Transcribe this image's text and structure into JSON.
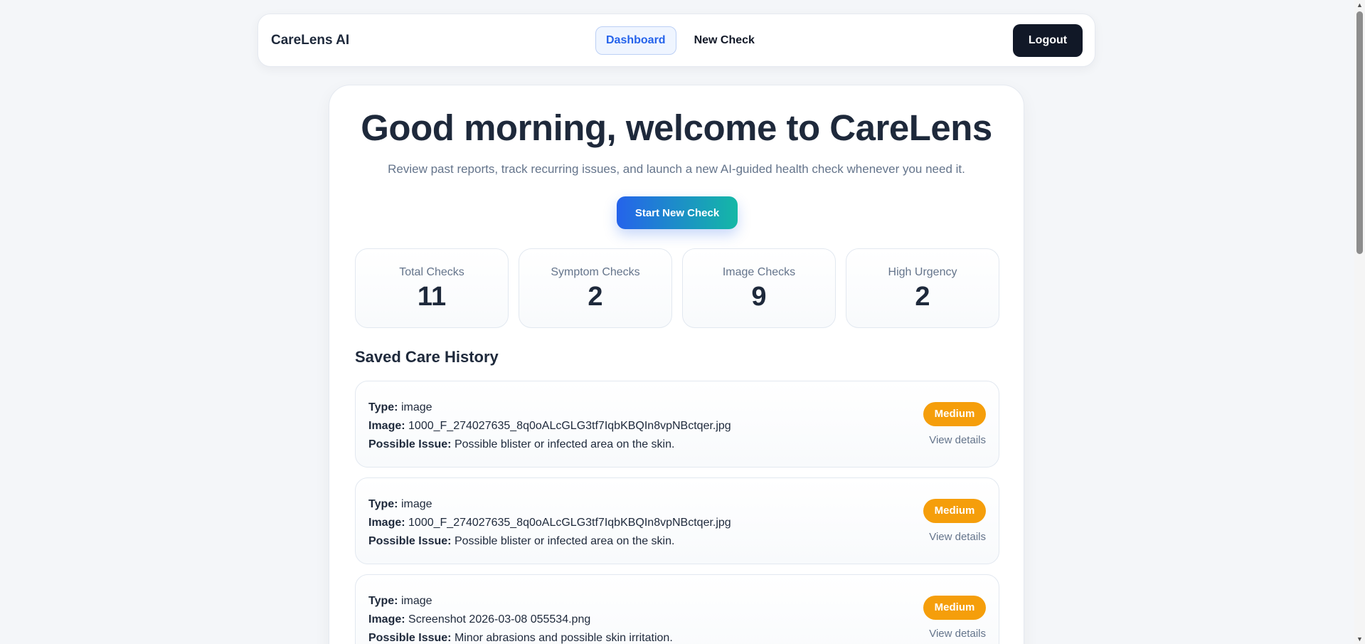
{
  "nav": {
    "brand": "CareLens AI",
    "links": [
      {
        "label": "Dashboard",
        "active": true
      },
      {
        "label": "New Check",
        "active": false
      }
    ],
    "logout_label": "Logout"
  },
  "hero": {
    "greeting": "Good morning, welcome to CareLens",
    "subtitle": "Review past reports, track recurring issues, and launch a new AI-guided health check whenever you need it.",
    "cta_label": "Start New Check"
  },
  "stats": [
    {
      "label": "Total Checks",
      "value": "11"
    },
    {
      "label": "Symptom Checks",
      "value": "2"
    },
    {
      "label": "Image Checks",
      "value": "9"
    },
    {
      "label": "High Urgency",
      "value": "2"
    }
  ],
  "history": {
    "title": "Saved Care History",
    "field_labels": {
      "type": "Type:",
      "image": "Image:",
      "issue": "Possible Issue:"
    },
    "view_label": "View details",
    "items": [
      {
        "type": "image",
        "image": "1000_F_274027635_8q0oALcGLG3tf7IqbKBQIn8vpNBctqer.jpg",
        "issue": "Possible blister or infected area on the skin.",
        "urgency": "Medium"
      },
      {
        "type": "image",
        "image": "1000_F_274027635_8q0oALcGLG3tf7IqbKBQIn8vpNBctqer.jpg",
        "issue": "Possible blister or infected area on the skin.",
        "urgency": "Medium"
      },
      {
        "type": "image",
        "image": "Screenshot 2026-03-08 055534.png",
        "issue": "Minor abrasions and possible skin irritation.",
        "urgency": "Medium"
      }
    ]
  },
  "colors": {
    "accent": "#2563eb",
    "teal": "#14b8a6",
    "badge_medium": "#f59e0b",
    "dark": "#111827"
  }
}
